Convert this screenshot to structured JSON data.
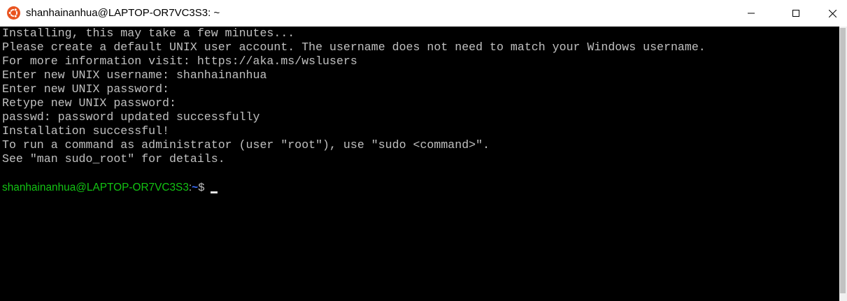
{
  "window": {
    "title": "shanhainanhua@LAPTOP-OR7VC3S3: ~",
    "icon": "ubuntu-icon",
    "controls": {
      "minimize": "minimize-icon",
      "maximize": "maximize-icon",
      "close": "close-icon"
    }
  },
  "terminal": {
    "lines": [
      "Installing, this may take a few minutes...",
      "Please create a default UNIX user account. The username does not need to match your Windows username.",
      "For more information visit: https://aka.ms/wslusers",
      "Enter new UNIX username: shanhainanhua",
      "Enter new UNIX password:",
      "Retype new UNIX password:",
      "passwd: password updated successfully",
      "Installation successful!",
      "To run a command as administrator (user \"root\"), use \"sudo <command>\".",
      "See \"man sudo_root\" for details."
    ],
    "prompt": {
      "user_host": "shanhainanhua@LAPTOP-OR7VC3S3",
      "colon": ":",
      "path": "~",
      "symbol": "$"
    }
  },
  "colors": {
    "background": "#000000",
    "text": "#c0c0c0",
    "prompt_user": "#13c413",
    "prompt_path": "#3b6fff",
    "ubuntu_orange": "#e95420"
  }
}
